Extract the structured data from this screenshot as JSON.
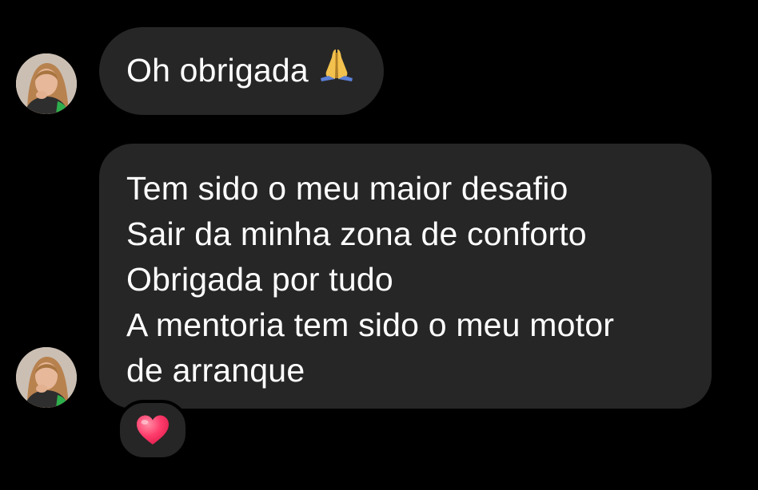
{
  "messages": [
    {
      "text": "Oh obrigada",
      "emoji": "folded-hands"
    },
    {
      "lines": [
        "Tem sido o meu maior desafio",
        "Sair da minha zona de conforto",
        "Obrigada por tudo",
        "A mentoria tem sido o meu motor",
        "de arranque"
      ],
      "reaction": "red-heart"
    }
  ],
  "colors": {
    "background": "#000000",
    "bubble": "#262626",
    "text": "#ffffff",
    "heart": "#ff3b6b"
  }
}
